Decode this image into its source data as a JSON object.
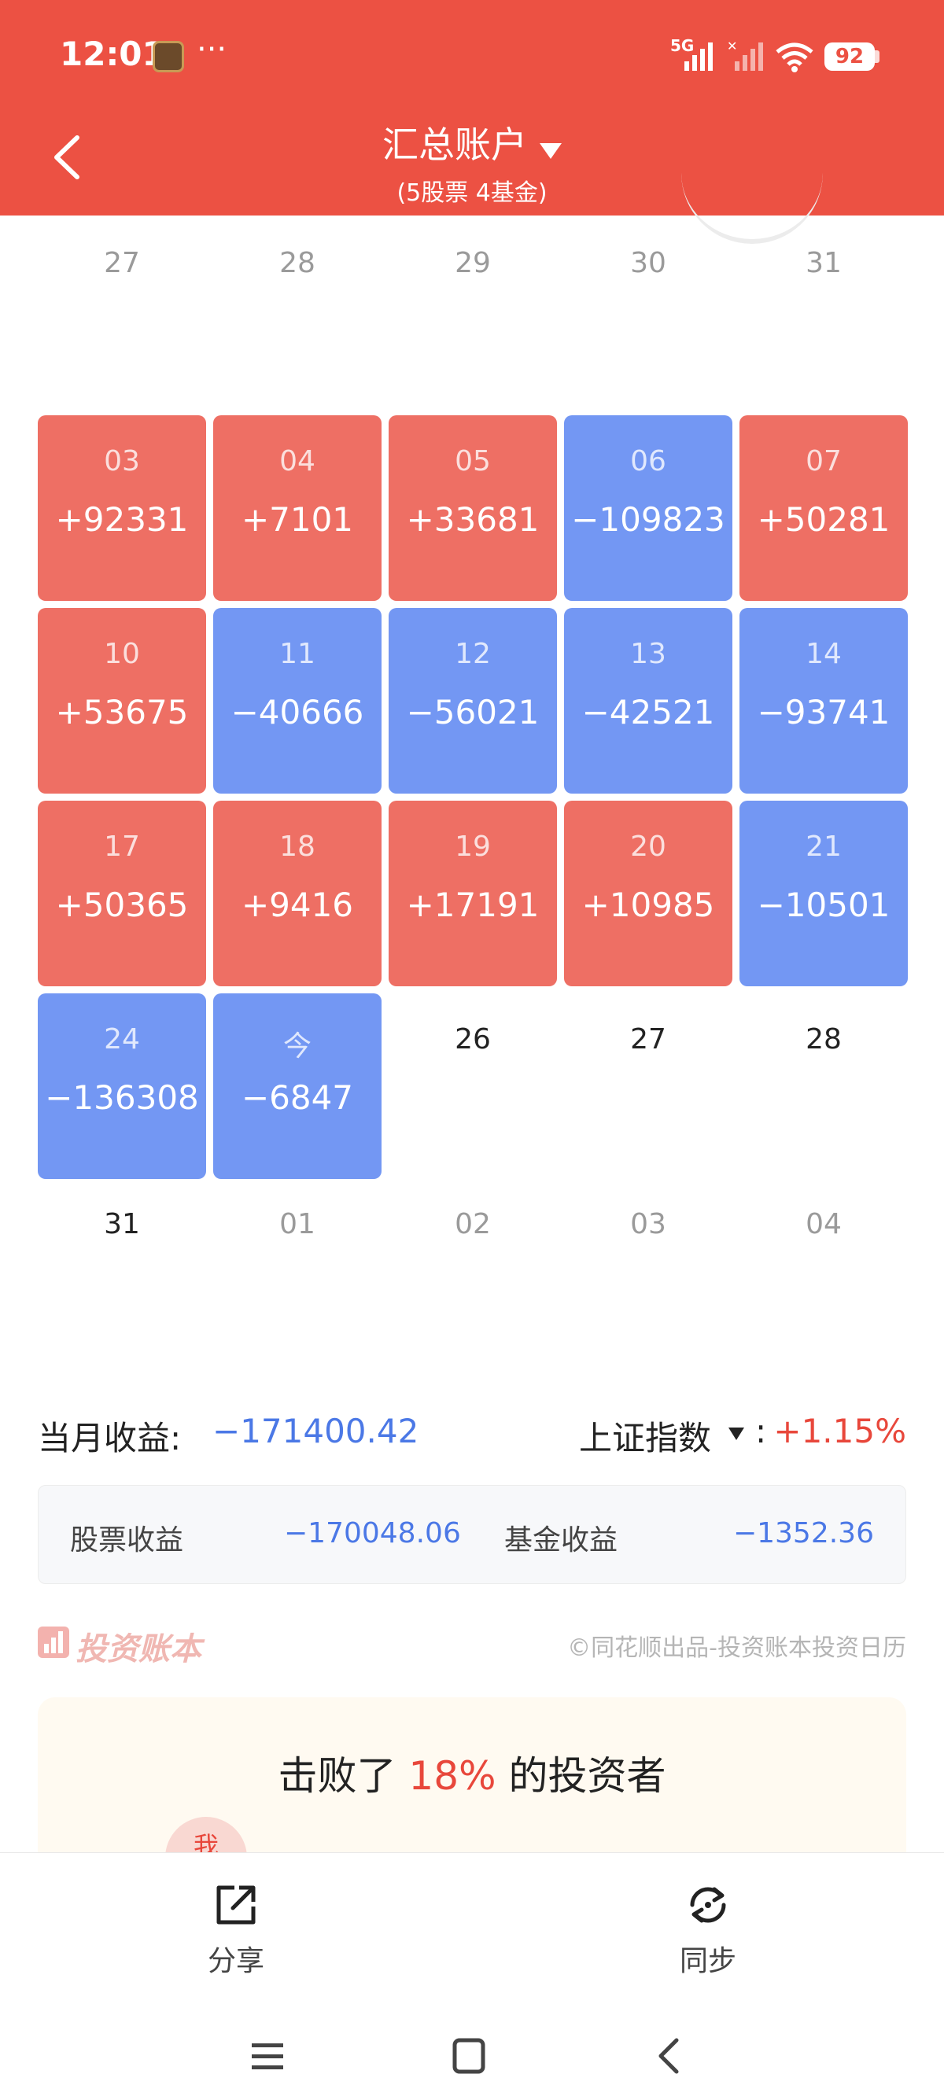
{
  "status_bar": {
    "time": "12:01",
    "more": "···",
    "network": "5G",
    "battery": "92"
  },
  "header": {
    "title": "汇总账户",
    "subtitle": "(5股票 4基金)",
    "bg_color": "#EC5143"
  },
  "calendar": {
    "prev_row": [
      "27",
      "28",
      "29",
      "30",
      "31"
    ],
    "cells": [
      {
        "date": "03",
        "value": "+92331",
        "tone": "red"
      },
      {
        "date": "04",
        "value": "+7101",
        "tone": "red"
      },
      {
        "date": "05",
        "value": "+33681",
        "tone": "red"
      },
      {
        "date": "06",
        "value": "−109823",
        "tone": "blue"
      },
      {
        "date": "07",
        "value": "+50281",
        "tone": "red"
      },
      {
        "date": "10",
        "value": "+53675",
        "tone": "red"
      },
      {
        "date": "11",
        "value": "−40666",
        "tone": "blue"
      },
      {
        "date": "12",
        "value": "−56021",
        "tone": "blue"
      },
      {
        "date": "13",
        "value": "−42521",
        "tone": "blue"
      },
      {
        "date": "14",
        "value": "−93741",
        "tone": "blue"
      },
      {
        "date": "17",
        "value": "+50365",
        "tone": "red"
      },
      {
        "date": "18",
        "value": "+9416",
        "tone": "red"
      },
      {
        "date": "19",
        "value": "+17191",
        "tone": "red"
      },
      {
        "date": "20",
        "value": "+10985",
        "tone": "red"
      },
      {
        "date": "21",
        "value": "−10501",
        "tone": "blue"
      },
      {
        "date": "24",
        "value": "−136308",
        "tone": "blue"
      },
      {
        "date": "今",
        "value": "−6847",
        "tone": "blue"
      },
      {
        "date": "26",
        "value": "",
        "tone": "empty"
      },
      {
        "date": "27",
        "value": "",
        "tone": "empty"
      },
      {
        "date": "28",
        "value": "",
        "tone": "empty"
      }
    ],
    "next_row": [
      {
        "date": "31",
        "tone": "dark"
      },
      {
        "date": "01",
        "tone": "muted"
      },
      {
        "date": "02",
        "tone": "muted"
      },
      {
        "date": "03",
        "tone": "muted"
      },
      {
        "date": "04",
        "tone": "muted"
      }
    ],
    "colors": {
      "gain": "#EE6F64",
      "loss": "#7397F3"
    }
  },
  "summary": {
    "month_label": "当月收益:",
    "month_value": "−171400.42",
    "index_label": "上证指数",
    "index_colon": ":",
    "index_value": "+1.15%"
  },
  "breakdown": {
    "stock_label": "股票收益",
    "stock_value": "−170048.06",
    "fund_label": "基金收益",
    "fund_value": "−1352.36"
  },
  "brand": {
    "name": "投资账本",
    "credit": "©同花顺出品-投资账本投资日历"
  },
  "beat": {
    "prefix": "击败了 ",
    "percent": "18%",
    "suffix": " 的投资者",
    "me": "我"
  },
  "toolbar": {
    "share_label": "分享",
    "sync_label": "同步"
  }
}
